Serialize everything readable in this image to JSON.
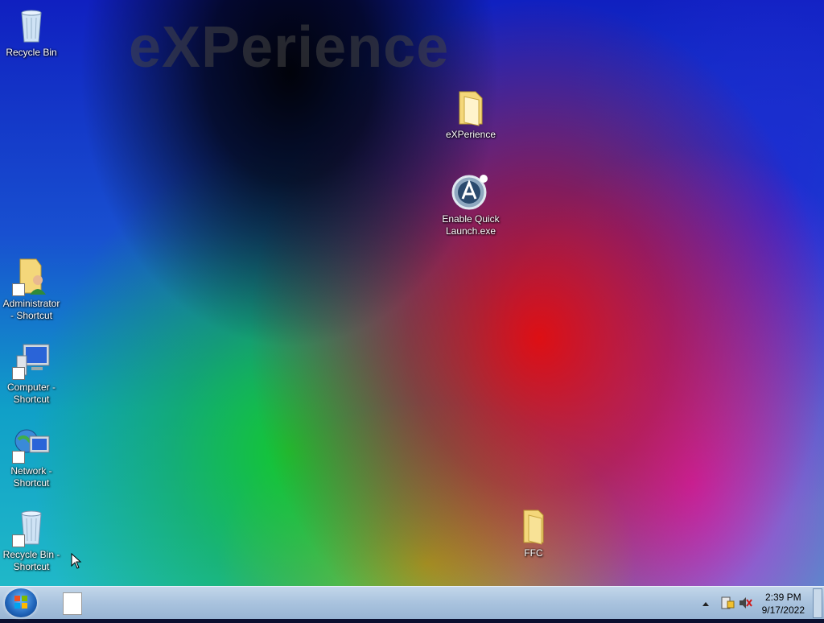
{
  "wallpaper": {
    "watermark": "eXPerience"
  },
  "desktop": {
    "icons": [
      {
        "label": "Recycle Bin"
      },
      {
        "label": "eXPerience"
      },
      {
        "label": "Enable Quick\nLaunch.exe"
      },
      {
        "label": "Administrator\n- Shortcut"
      },
      {
        "label": "Computer -\nShortcut"
      },
      {
        "label": "Network -\nShortcut"
      },
      {
        "label": "Recycle Bin -\nShortcut"
      },
      {
        "label": "FFC"
      }
    ]
  },
  "taskbar": {
    "clock": {
      "time": "2:39 PM",
      "date": "9/17/2022"
    }
  }
}
